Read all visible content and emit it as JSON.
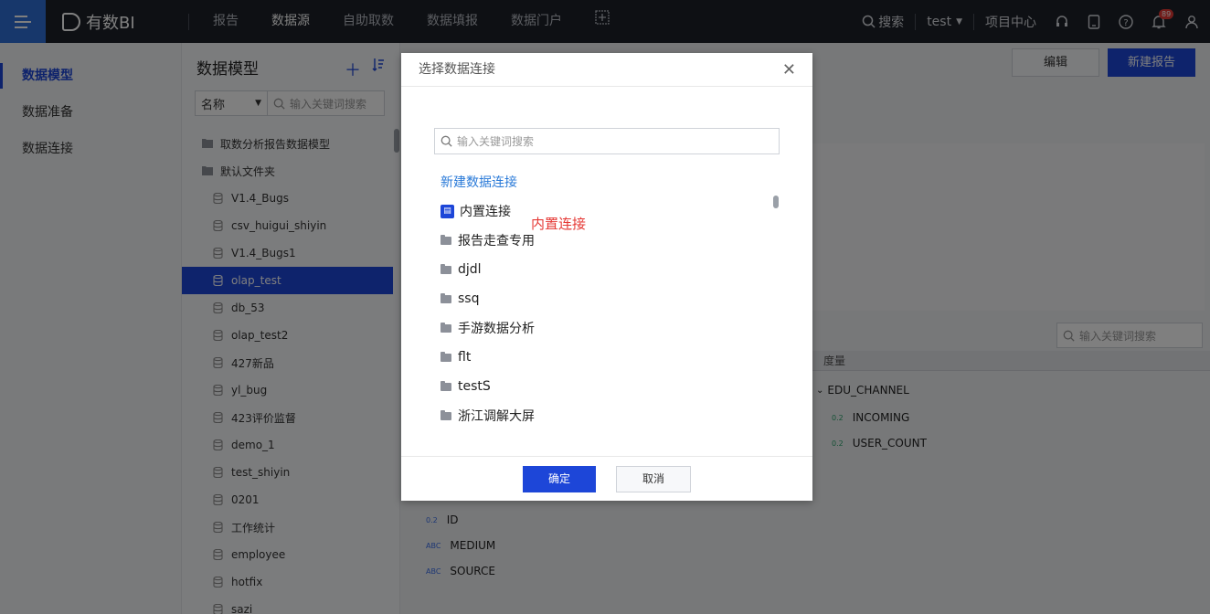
{
  "topbar": {
    "logo_text": "有数BI",
    "nav": [
      "报告",
      "数据源",
      "自助取数",
      "数据填报",
      "数据门户"
    ],
    "active_nav": "数据源",
    "search_label": "搜索",
    "user_label": "test",
    "project_center": "项目中心",
    "notification_count": "89"
  },
  "leftnav": {
    "items": [
      "数据模型",
      "数据准备",
      "数据连接"
    ],
    "active": "数据模型"
  },
  "tree": {
    "title": "数据模型",
    "filter_select": "名称",
    "search_placeholder": "输入关键词搜索",
    "folders": [
      "取数分析报告数据模型",
      "默认文件夹"
    ],
    "items": [
      "V1.4_Bugs",
      "csv_huigui_shiyin",
      "V1.4_Bugs1",
      "olap_test",
      "db_53",
      "olap_test2",
      "427新品",
      "yl_bug",
      "423评价监督",
      "demo_1",
      "test_shiyin",
      "0201",
      "工作统计",
      "employee",
      "hotfix",
      "sazi"
    ],
    "selected": "olap_test"
  },
  "main": {
    "edit_button": "编辑",
    "new_report_button": "新建报告",
    "field_search_placeholder": "输入关键词搜索",
    "measure_header": "度量",
    "measure_group": "EDU_CHANNEL",
    "measures": [
      {
        "type": "0.2",
        "name": "INCOMING"
      },
      {
        "type": "0.2",
        "name": "USER_COUNT"
      }
    ],
    "dimensions": [
      {
        "type": "0.2",
        "name": "ID"
      },
      {
        "type": "ABC",
        "name": "MEDIUM"
      },
      {
        "type": "ABC",
        "name": "SOURCE"
      }
    ]
  },
  "dialog": {
    "title": "选择数据连接",
    "search_placeholder": "输入关键词搜索",
    "new_connection_link": "新建数据连接",
    "builtin_item": "内置连接",
    "annotation": "内置连接",
    "items": [
      "报告走查专用",
      "djdl",
      "ssq",
      "手游数据分析",
      "flt",
      "testS",
      "浙江调解大屏"
    ],
    "ok_button": "确定",
    "cancel_button": "取消"
  },
  "colors": {
    "primary": "#1d46d8",
    "topbar": "#1d2129",
    "annotation": "#e53935",
    "link": "#2a7ad8"
  }
}
